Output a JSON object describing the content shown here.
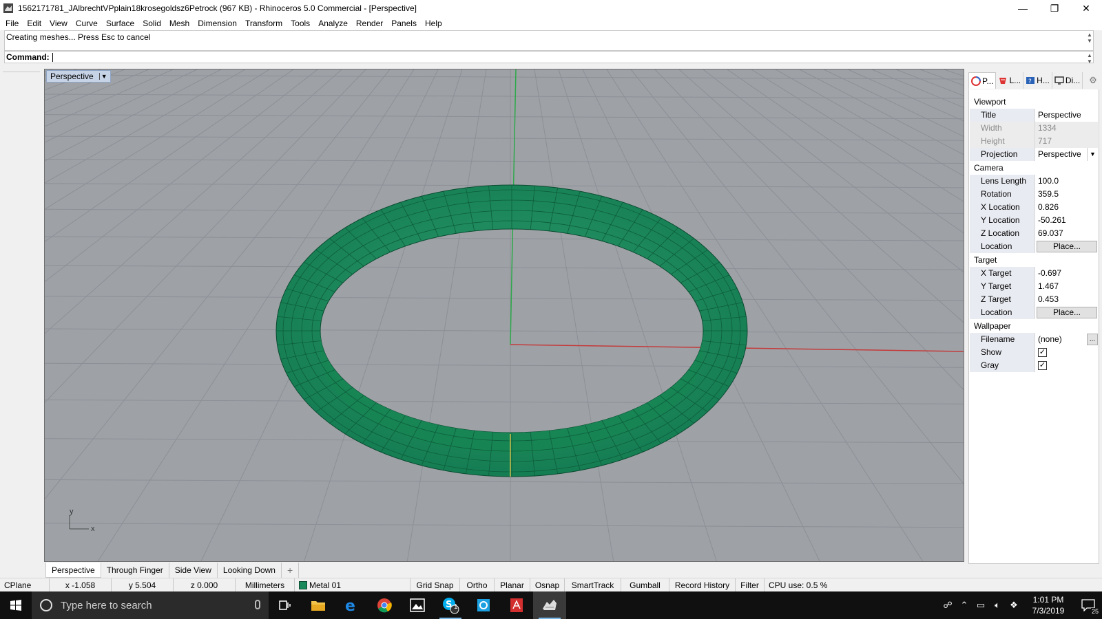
{
  "window": {
    "title": "1562171781_JAlbrechtVPplain18krosegoldsz6Petrock (967 KB) - Rhinoceros 5.0 Commercial - [Perspective]",
    "controls": {
      "minimize": "—",
      "restore": "❐",
      "close": "✕"
    }
  },
  "menu": [
    "File",
    "Edit",
    "View",
    "Curve",
    "Surface",
    "Solid",
    "Mesh",
    "Dimension",
    "Transform",
    "Tools",
    "Analyze",
    "Render",
    "Panels",
    "Help"
  ],
  "command": {
    "history": "Creating meshes... Press Esc to cancel",
    "prompt": "Command:",
    "value": ""
  },
  "viewport": {
    "active_label": "Perspective",
    "dropdown_icon": "triangle-down",
    "axis_labels": {
      "x": "x",
      "y": "y"
    },
    "object_color": "#1a8a5c",
    "tabs": [
      "Perspective",
      "Through Finger",
      "Side View",
      "Looking Down",
      "+"
    ]
  },
  "panel": {
    "tabs": [
      {
        "label": "P...",
        "icon": "properties-icon"
      },
      {
        "label": "L...",
        "icon": "layers-icon"
      },
      {
        "label": "H...",
        "icon": "help-icon"
      },
      {
        "label": "Di...",
        "icon": "display-icon"
      }
    ],
    "sections": {
      "viewport": "Viewport",
      "camera": "Camera",
      "target": "Target",
      "wallpaper": "Wallpaper"
    },
    "viewport_rows": {
      "title": {
        "k": "Title",
        "v": "Perspective"
      },
      "width": {
        "k": "Width",
        "v": "1334"
      },
      "height": {
        "k": "Height",
        "v": "717"
      },
      "projection": {
        "k": "Projection",
        "v": "Perspective"
      }
    },
    "camera_rows": {
      "lens": {
        "k": "Lens Length",
        "v": "100.0"
      },
      "rotation": {
        "k": "Rotation",
        "v": "359.5"
      },
      "xloc": {
        "k": "X Location",
        "v": "0.826"
      },
      "yloc": {
        "k": "Y Location",
        "v": "-50.261"
      },
      "zloc": {
        "k": "Z Location",
        "v": "69.037"
      },
      "location": {
        "k": "Location",
        "v": "Place..."
      }
    },
    "target_rows": {
      "xt": {
        "k": "X Target",
        "v": "-0.697"
      },
      "yt": {
        "k": "Y Target",
        "v": "1.467"
      },
      "zt": {
        "k": "Z Target",
        "v": "0.453"
      },
      "location": {
        "k": "Location",
        "v": "Place..."
      }
    },
    "wallpaper_rows": {
      "filename": {
        "k": "Filename",
        "v": "(none)",
        "btn": "..."
      },
      "show": {
        "k": "Show",
        "checked": true
      },
      "gray": {
        "k": "Gray",
        "checked": true
      }
    }
  },
  "status": {
    "cplane": "CPlane",
    "x": "x -1.058",
    "y": "y 5.504",
    "z": "z 0.000",
    "units": "Millimeters",
    "layer": "Metal 01",
    "layer_color": "#1a8a5c",
    "toggles": [
      "Grid Snap",
      "Ortho",
      "Planar",
      "Osnap",
      "SmartTrack",
      "Gumball",
      "Record History",
      "Filter"
    ],
    "cpu": "CPU use: 0.5 %"
  },
  "taskbar": {
    "search_placeholder": "Type here to search",
    "skype_badge": "1",
    "time": "1:01 PM",
    "date": "7/3/2019",
    "notifications": "25"
  }
}
